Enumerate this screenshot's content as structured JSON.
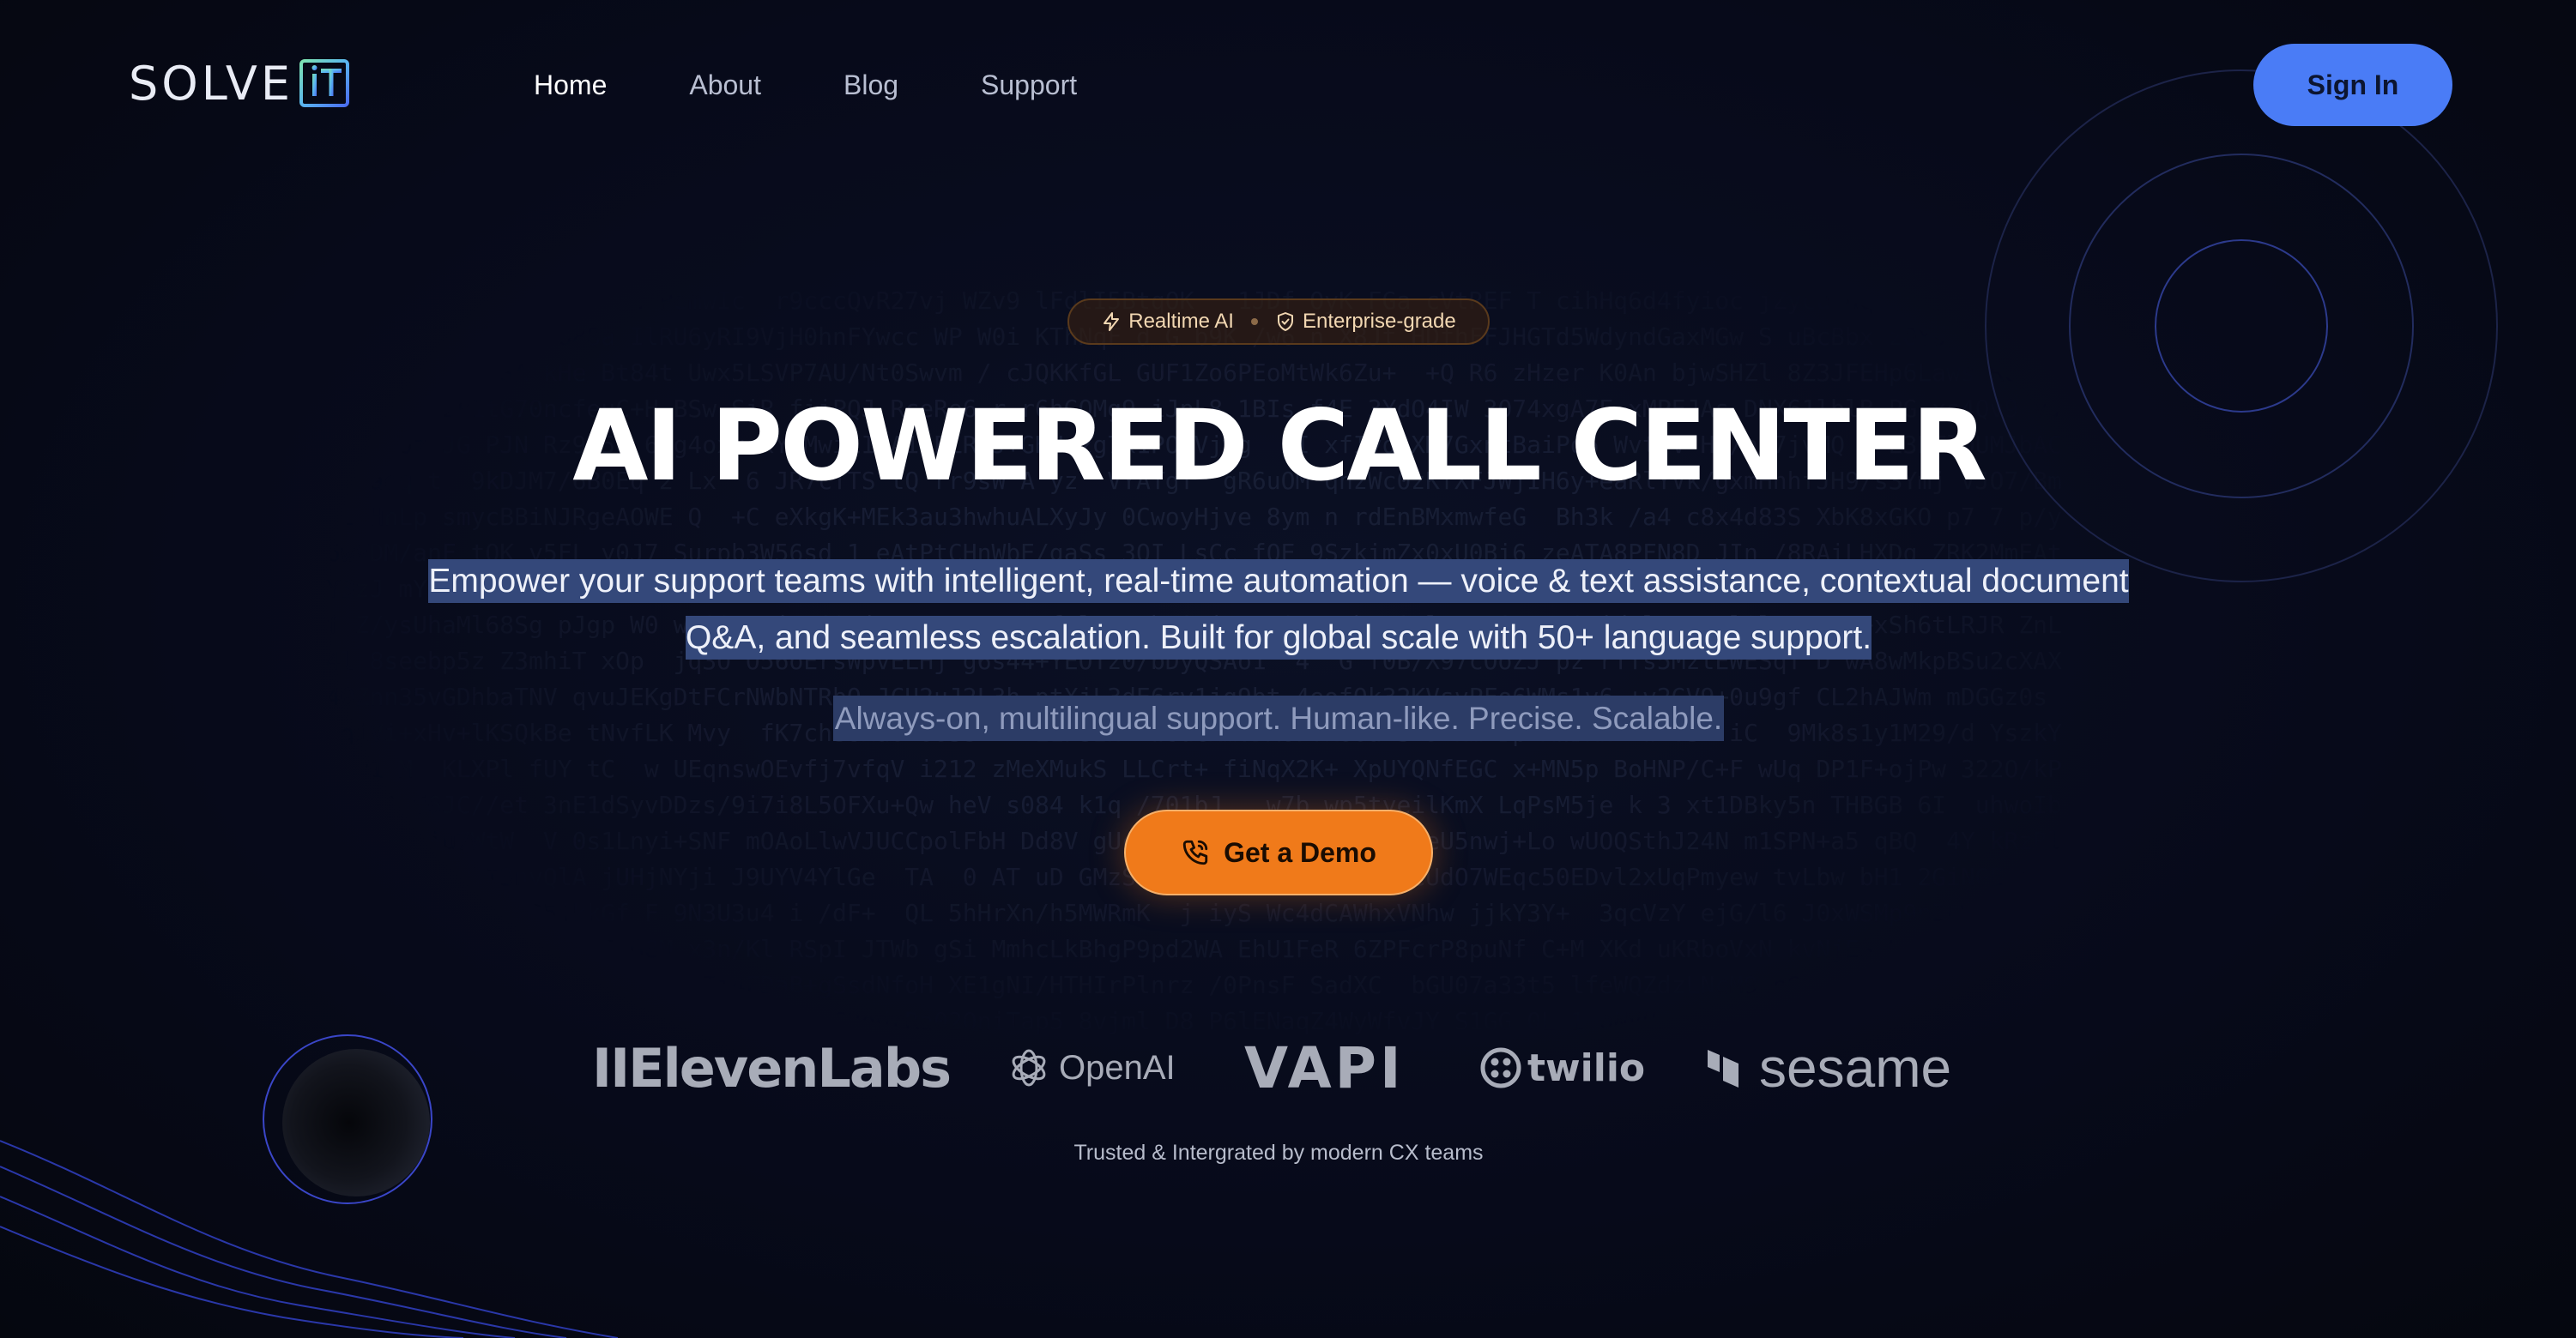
{
  "nav": {
    "logo_text": "SOLVE",
    "logo_mark": "iT",
    "links": [
      "Home",
      "About",
      "Blog",
      "Support"
    ],
    "active": "Home",
    "signin_label": "Sign In"
  },
  "hero": {
    "badge_left": "Realtime AI",
    "badge_right": "Enterprise-grade",
    "headline": "AI POWERED CALL CENTER",
    "subtitle": "Empower your support teams with intelligent, real-time automation — voice & text assistance, contextual document Q&A, and seamless escalation. Built for global scale with 50+ language support.",
    "tagline": "Always-on, multilingual support. Human-like. Precise. Scalable.",
    "cta_label": "Get a Demo"
  },
  "partners": {
    "logos": [
      "IIElevenLabs",
      "OpenAI",
      "VAPI",
      "twilio",
      "sesame"
    ],
    "caption": "Trusted & Intergrated by modern CX teams"
  },
  "colors": {
    "background": "#070a1a",
    "accent_blue": "#4a7cf6",
    "accent_orange": "#f07a1a"
  },
  "icons": {
    "badge_left": "lightning-icon",
    "badge_right": "shield-icon",
    "cta": "phone-icon"
  }
}
